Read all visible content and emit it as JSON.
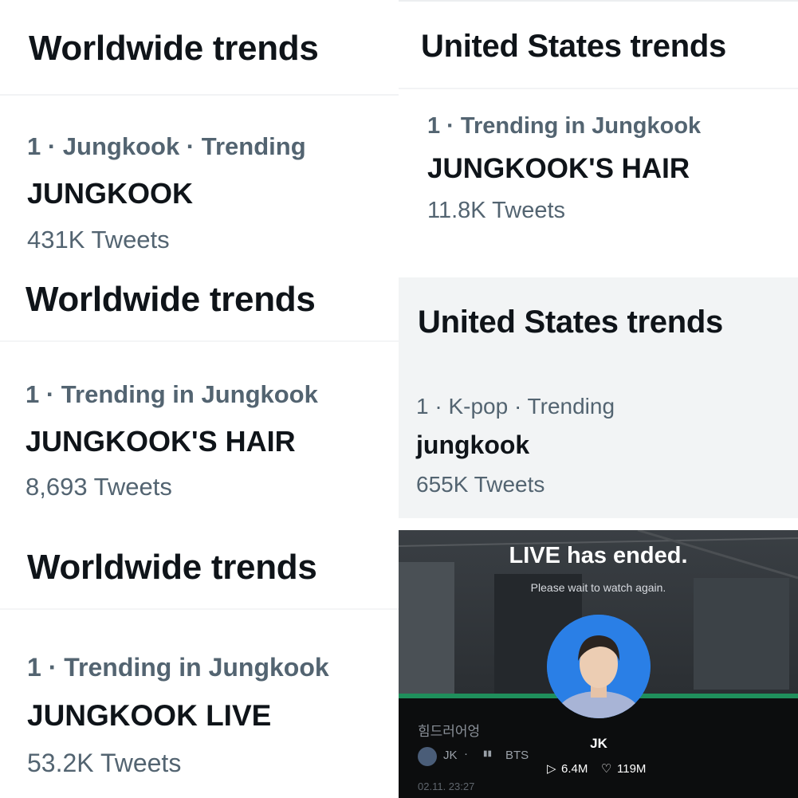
{
  "panels": {
    "ww1": {
      "heading": "Worldwide trends",
      "meta": "1 · Jungkook · Trending",
      "trend": "JUNGKOOK",
      "count": "431K Tweets"
    },
    "us1": {
      "heading": "United States trends",
      "meta": "1 · Trending in Jungkook",
      "trend": "JUNGKOOK'S HAIR",
      "count": "11.8K Tweets"
    },
    "ww2": {
      "heading": "Worldwide trends",
      "meta": "1 · Trending in Jungkook",
      "trend": "JUNGKOOK'S HAIR",
      "count": "8,693 Tweets"
    },
    "us2": {
      "heading": "United States trends",
      "meta": "1 · K-pop · Trending",
      "trend": "jungkook",
      "count": "655K Tweets"
    },
    "ww3": {
      "heading": "Worldwide trends",
      "meta": "1 · Trending in Jungkook",
      "trend": "JUNGKOOK LIVE",
      "count": "53.2K Tweets"
    }
  },
  "live": {
    "title": "LIVE has ended.",
    "subtitle": "Please wait to watch again.",
    "channel_korean": "힘드러어엉",
    "user": "JK",
    "chip_user": "JK",
    "chip_group": "BTS",
    "plays": "6.4M",
    "likes": "119M",
    "date": "02.11. 23:27"
  },
  "colors": {
    "text": "#0f1419",
    "secondary": "#536471",
    "avatar_bg": "#2a7fe6"
  }
}
